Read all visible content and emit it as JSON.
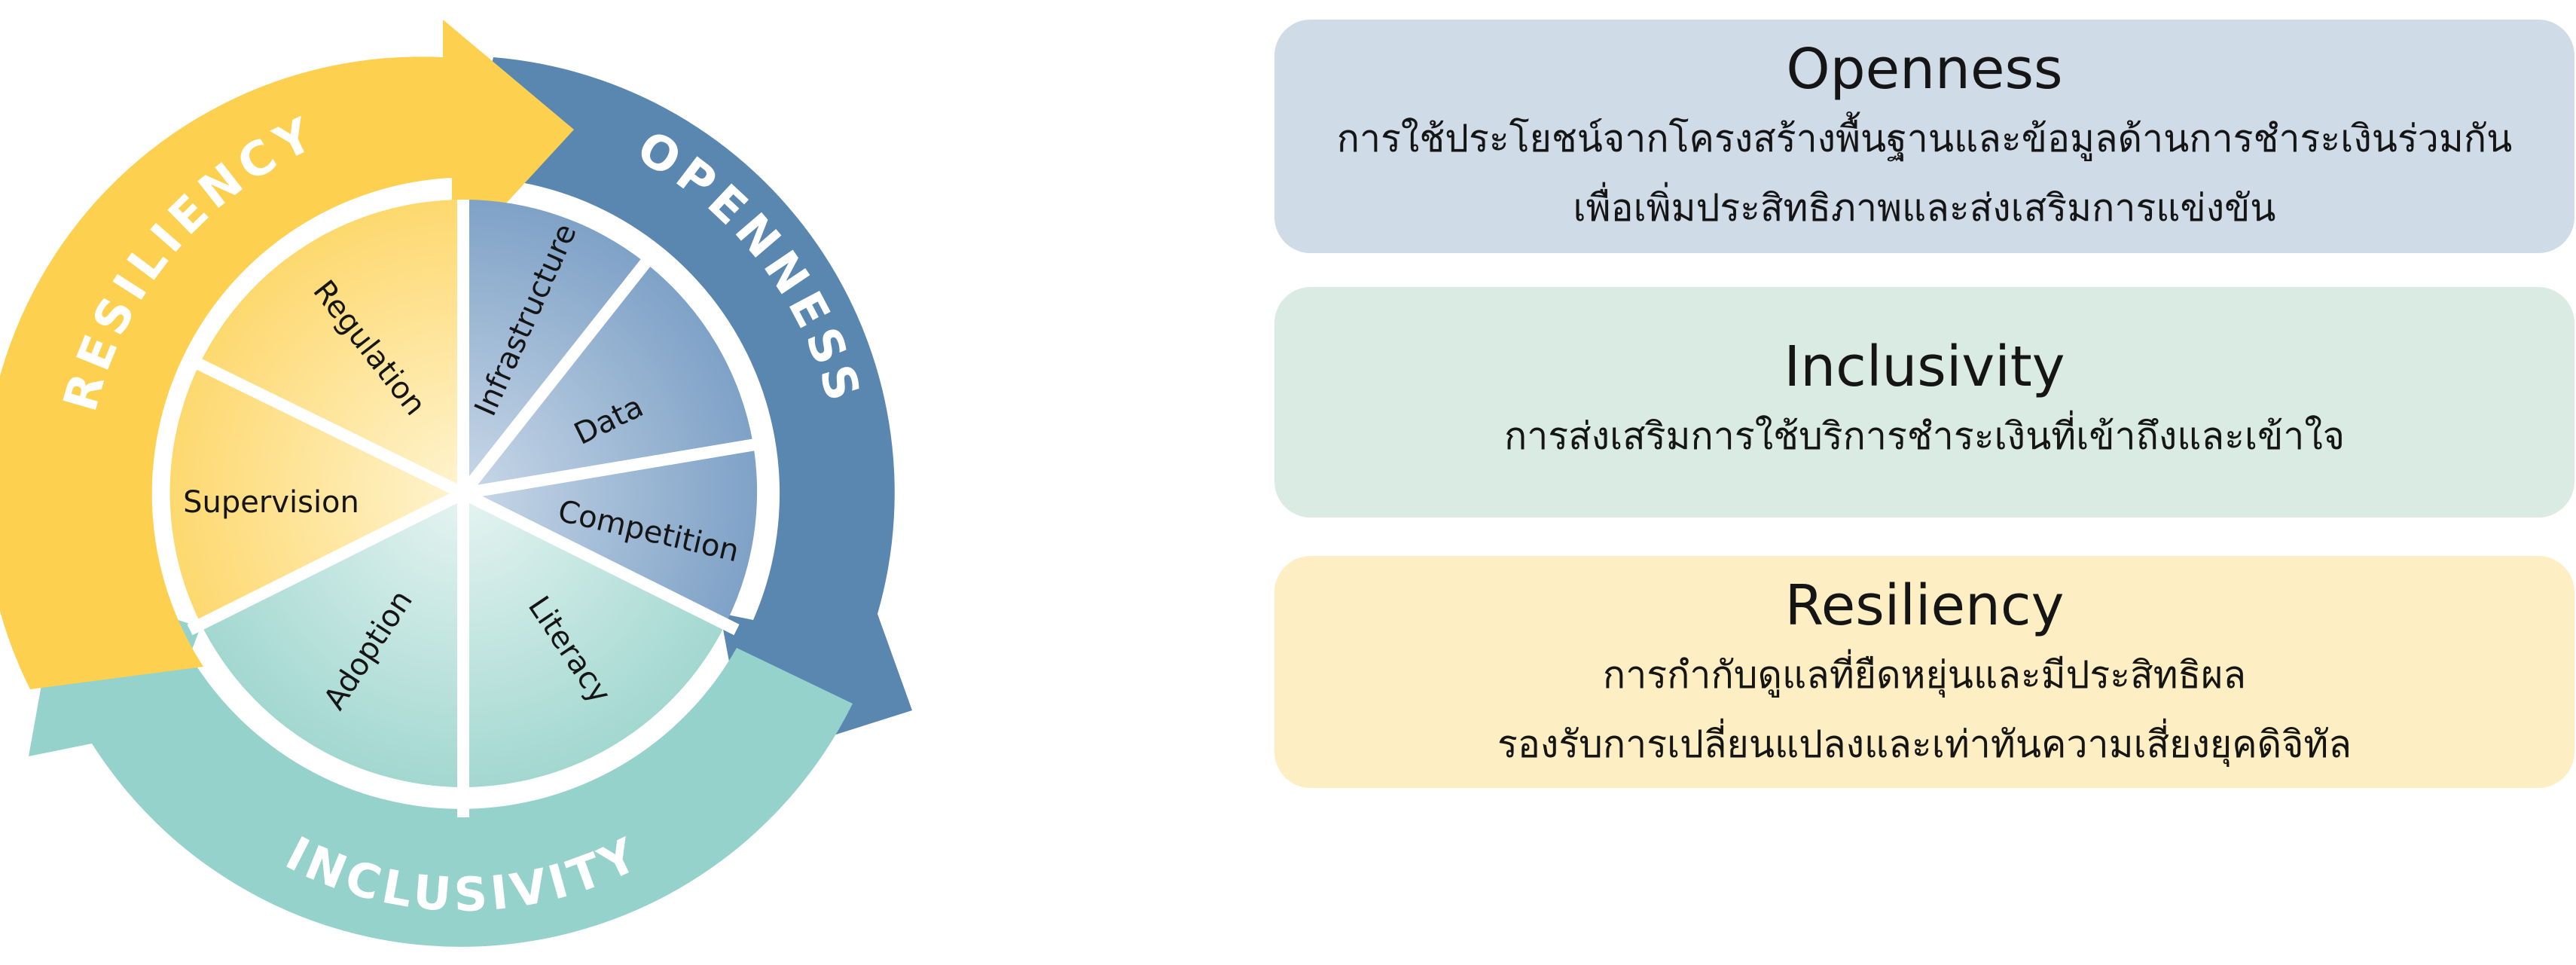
{
  "ring": {
    "resiliency": "RESILIENCY",
    "openness": "OPENNESS",
    "inclusivity": "INCLUSIVITY"
  },
  "segments": {
    "regulation": "Regulation",
    "supervision": "Supervision",
    "infrastructure": "Infrastructure",
    "data": "Data",
    "competition": "Competition",
    "literacy": "Literacy",
    "adoption": "Adoption"
  },
  "cards": {
    "openness": {
      "title": "Openness",
      "lines": [
        "การใช้ประโยชน์จากโครงสร้างพื้นฐานและข้อมูลด้านการชำระเงินร่วมกัน",
        "เพื่อเพิ่มประสิทธิภาพและส่งเสริมการแข่งขัน"
      ]
    },
    "inclusivity": {
      "title": "Inclusivity",
      "lines": [
        "การส่งเสริมการใช้บริการชำระเงินที่เข้าถึงและเข้าใจ"
      ]
    },
    "resiliency": {
      "title": "Resiliency",
      "lines": [
        "การกำกับดูแลที่ยืดหยุ่นและมีประสิทธิผล",
        "รองรับการเปลี่ยนแปลงและเท่าทันความเสี่ยงยุคดิจิทัล"
      ]
    }
  },
  "colors": {
    "yellow": "#fdd04f",
    "blue": "#5a87b0",
    "teal": "#96d2cc",
    "yellow_pie": "#fde7a6",
    "blue_pie": "#8fadcd",
    "teal_pie": "#b8e0da"
  }
}
